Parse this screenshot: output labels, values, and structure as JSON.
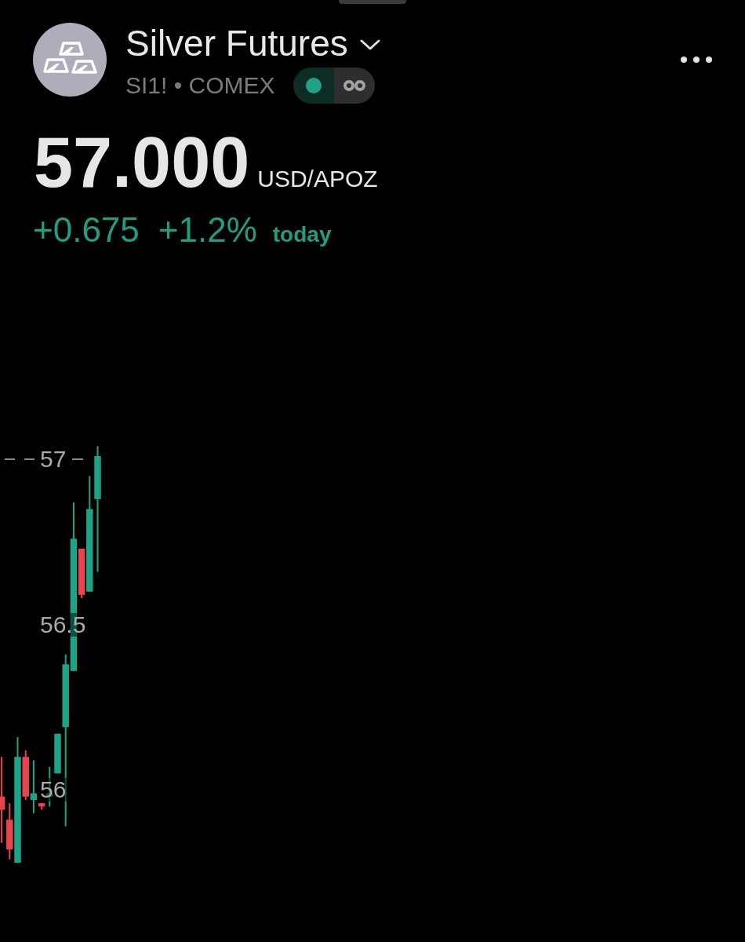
{
  "instrument": {
    "name": "Silver Futures",
    "ticker_line": "SI1! • COMEX",
    "market_open": true
  },
  "quote": {
    "price": "57.000",
    "unit": "USD/APOZ",
    "change": "+0.675",
    "change_percent": "+1.2%",
    "period": "today",
    "rising": true
  },
  "chart": {
    "chart_data": {
      "type": "candlestick",
      "ohlc": [
        [
          55.98,
          56.1,
          55.84,
          55.94
        ],
        [
          55.91,
          55.96,
          55.79,
          55.82
        ],
        [
          55.78,
          56.16,
          55.78,
          56.1
        ],
        [
          56.1,
          56.12,
          55.97,
          55.98
        ],
        [
          55.97,
          56.09,
          55.93,
          55.99
        ],
        [
          55.96,
          55.96,
          55.94,
          55.95
        ],
        [
          55.98,
          56.07,
          55.95,
          55.99
        ],
        [
          56.05,
          56.17,
          56.05,
          56.17
        ],
        [
          56.19,
          56.41,
          55.89,
          56.38
        ],
        [
          56.36,
          56.87,
          56.36,
          56.76
        ],
        [
          56.73,
          56.73,
          56.58,
          56.59
        ],
        [
          56.6,
          56.95,
          56.6,
          56.85
        ],
        [
          56.88,
          57.04,
          56.66,
          57.01
        ]
      ],
      "ylim": [
        55.54,
        58.39
      ],
      "yticks": [
        {
          "value": 57,
          "label": "57"
        },
        {
          "value": 56.5,
          "label": "56.5"
        },
        {
          "value": 56,
          "label": "56"
        }
      ],
      "ref_lines": [
        {
          "axis": "y",
          "value": 57
        }
      ]
    }
  }
}
